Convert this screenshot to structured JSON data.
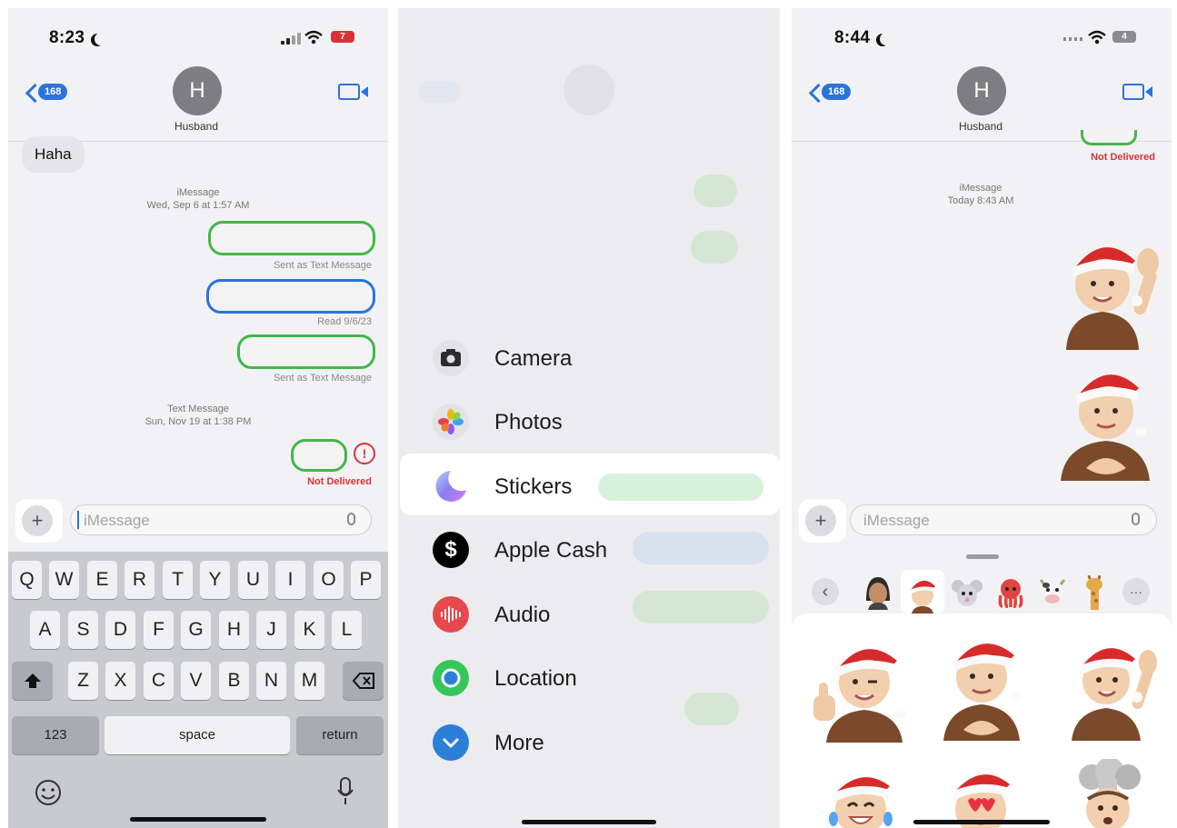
{
  "panel1": {
    "status": {
      "time": "8:23",
      "battery": "7"
    },
    "header": {
      "back_count": "168",
      "avatar_letter": "H",
      "contact_name": "Husband"
    },
    "messages": {
      "received_text": "Haha",
      "group1_service": "iMessage",
      "group1_date": "Wed, Sep 6 at 1:57 AM",
      "note_sent_text_1": "Sent as Text Message",
      "note_read": "Read 9/6/23",
      "note_sent_text_2": "Sent as Text Message",
      "group2_service": "Text Message",
      "group2_date": "Sun, Nov 19 at 1:38 PM",
      "error_glyph": "!",
      "not_delivered": "Not Delivered"
    },
    "compose": {
      "plus": "+",
      "placeholder": "iMessage"
    },
    "keyboard": {
      "row1": [
        "Q",
        "W",
        "E",
        "R",
        "T",
        "Y",
        "U",
        "I",
        "O",
        "P"
      ],
      "row2": [
        "A",
        "S",
        "D",
        "F",
        "G",
        "H",
        "J",
        "K",
        "L"
      ],
      "row3": [
        "Z",
        "X",
        "C",
        "V",
        "B",
        "N",
        "M"
      ],
      "numbers": "123",
      "space": "space",
      "return": "return"
    }
  },
  "panel2": {
    "menu": [
      {
        "label": "Camera",
        "icon": "camera-icon",
        "color": "#3a3a3c"
      },
      {
        "label": "Photos",
        "icon": "photos-icon",
        "color": "#f2f2f2"
      },
      {
        "label": "Stickers",
        "icon": "stickers-icon",
        "color": "#8a7cf0"
      },
      {
        "label": "Apple Cash",
        "icon": "apple-cash-icon",
        "color": "#000000"
      },
      {
        "label": "Audio",
        "icon": "audio-icon",
        "color": "#e5484d"
      },
      {
        "label": "Location",
        "icon": "location-icon",
        "color": "#34c759"
      },
      {
        "label": "More",
        "icon": "more-icon",
        "color": "#2b7fd9"
      }
    ],
    "dollar_glyph": "$"
  },
  "panel3": {
    "status": {
      "time": "8:44",
      "battery": "4"
    },
    "header": {
      "back_count": "168",
      "avatar_letter": "H",
      "contact_name": "Husband"
    },
    "messages": {
      "not_delivered": "Not Delivered",
      "service": "iMessage",
      "date": "Today 8:43 AM"
    },
    "compose": {
      "plus": "+",
      "placeholder": "iMessage"
    },
    "tray": {
      "more_glyph": "···",
      "back_glyph": "‹"
    }
  },
  "colors": {
    "imessage_blue": "#2b74d9",
    "sms_green": "#45b649",
    "error_red": "#d9333a"
  }
}
